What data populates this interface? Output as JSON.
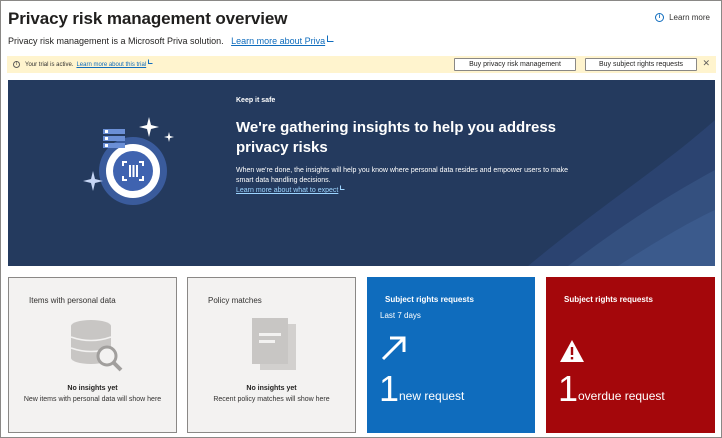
{
  "header": {
    "title": "Privacy risk management overview",
    "learn_more": "Learn more"
  },
  "subtitle": {
    "text": "Privacy risk management is a Microsoft Priva solution.",
    "link": "Learn more about Priva"
  },
  "trial_bar": {
    "message": "Your trial is active.",
    "link": "Learn more about this trial",
    "buy_risk_button": "Buy privacy risk management",
    "buy_srr_button": "Buy subject rights requests",
    "close_icon": "close-icon"
  },
  "hero": {
    "kicker": "Keep it safe",
    "heading": "We're gathering insights to help you address privacy risks",
    "body": "When we're done, the insights will help you know where personal data resides and empower users to make smart data handling decisions.",
    "link": "Learn more about what to expect",
    "colors": {
      "background": "#243a5e",
      "accent": "#4a6db0"
    }
  },
  "cards": {
    "items_personal": {
      "title": "Items with personal data",
      "status": "No insights yet",
      "description": "New items with personal data will show here"
    },
    "policy_matches": {
      "title": "Policy matches",
      "status": "No insights yet",
      "description": "Recent policy matches will show here"
    },
    "srr_new": {
      "title": "Subject rights requests",
      "period": "Last 7 days",
      "count": "1",
      "label": "new request",
      "color": "#0f6cbd"
    },
    "srr_overdue": {
      "title": "Subject rights requests",
      "count": "1",
      "label": "overdue request",
      "color": "#a4070b"
    }
  }
}
